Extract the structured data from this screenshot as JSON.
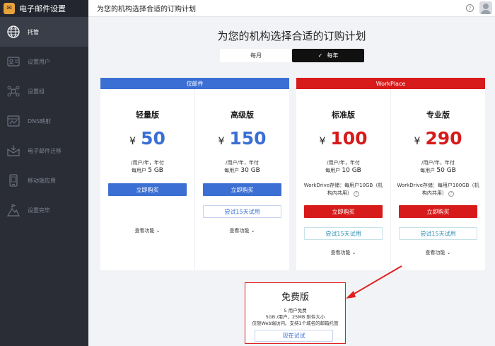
{
  "sidebar": {
    "title": "电子邮件设置",
    "items": [
      {
        "label": "托管",
        "icon": "globe-icon",
        "active": true
      },
      {
        "label": "设置用户",
        "icon": "user-card-icon"
      },
      {
        "label": "设置组",
        "icon": "group-icon"
      },
      {
        "label": "DNS映射",
        "icon": "dns-icon"
      },
      {
        "label": "电子邮件迁移",
        "icon": "mail-migrate-icon"
      },
      {
        "label": "移动端应用",
        "icon": "mobile-icon"
      },
      {
        "label": "设置完毕",
        "icon": "flag-icon"
      }
    ]
  },
  "topbar": {
    "title": "为您的机构选择合适的订购计划",
    "help": "?"
  },
  "main": {
    "heading": "为您的机构选择合适的订购计划",
    "billing": {
      "monthly": "每月",
      "yearly": "每年",
      "selected": "yearly"
    },
    "groups": [
      {
        "name": "仅邮件",
        "color": "#3b6fd4"
      },
      {
        "name": "WorkPlace",
        "color": "#d71a1a"
      }
    ],
    "currency": "¥",
    "plans": [
      {
        "name": "轻量版",
        "price": "50",
        "unit": "/用户/年，年付",
        "storage_prefix": "每用户",
        "storage": "5 GB",
        "buy": "立即购买",
        "features": "查看功能"
      },
      {
        "name": "高级版",
        "price": "150",
        "unit": "/用户/年，年付",
        "storage_prefix": "每用户",
        "storage": "30 GB",
        "buy": "立即购买",
        "trial": "尝试15天试用",
        "features": "查看功能"
      },
      {
        "name": "标准版",
        "price": "100",
        "unit": "/用户/年，年付",
        "storage_prefix": "每用户",
        "storage": "10 GB",
        "workdrive": "WorkDrive存储：每用户10GB（机构内共用）",
        "buy": "立即购买",
        "trial": "尝试15天试用",
        "features": "查看功能"
      },
      {
        "name": "专业版",
        "price": "290",
        "unit": "/用户/年，年付",
        "storage_prefix": "每用户",
        "storage": "50 GB",
        "workdrive": "WorkDrive存储：每用户100GB（机构内共用）",
        "buy": "立即购买",
        "trial": "尝试15天试用",
        "features": "查看功能"
      }
    ],
    "free": {
      "title": "免费版",
      "line1": "5 用户免费",
      "line2": "5GB /用户，25MB 附件大小",
      "line3": "仅限Web端访问。支持1个域名的邮箱托管",
      "button": "现在试试"
    }
  }
}
